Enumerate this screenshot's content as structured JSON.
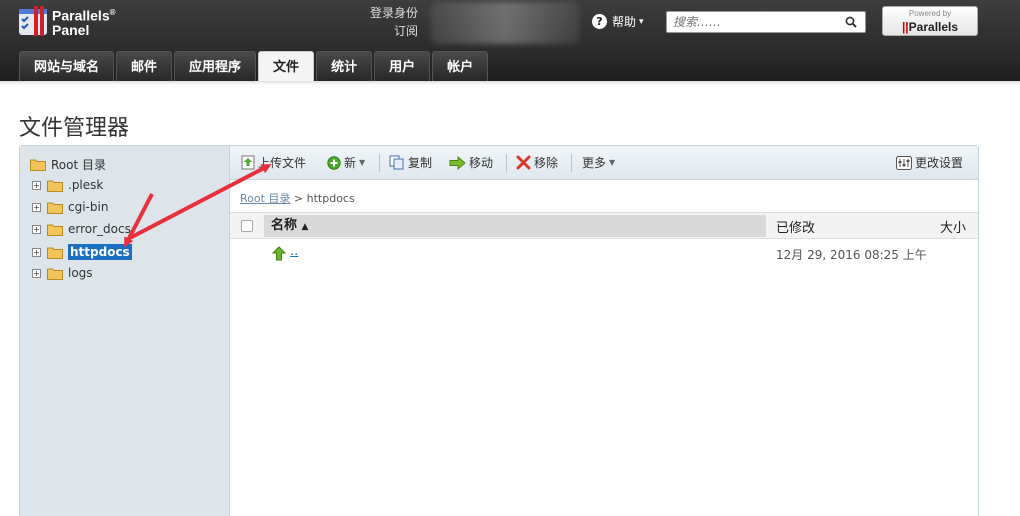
{
  "header": {
    "logo_line1": "Parallels",
    "logo_sup": "®",
    "logo_line2": "Panel",
    "login_label": "登录身份",
    "subscription_label": "订阅",
    "help_label": "帮助",
    "search_placeholder": "搜索……",
    "badge_top": "Powered by",
    "badge_main": "Parallels"
  },
  "tabs": [
    {
      "label": "网站与域名",
      "active": false
    },
    {
      "label": "邮件",
      "active": false
    },
    {
      "label": "应用程序",
      "active": false
    },
    {
      "label": "文件",
      "active": true
    },
    {
      "label": "统计",
      "active": false
    },
    {
      "label": "用户",
      "active": false
    },
    {
      "label": "帐户",
      "active": false
    }
  ],
  "page": {
    "title": "文件管理器"
  },
  "sidebar": {
    "root_label": "Root 目录",
    "items": [
      {
        "label": ".plesk",
        "selected": false
      },
      {
        "label": "cgi-bin",
        "selected": false
      },
      {
        "label": "error_docs",
        "selected": false
      },
      {
        "label": "httpdocs",
        "selected": true
      },
      {
        "label": "logs",
        "selected": false
      }
    ]
  },
  "toolbar": {
    "upload_label": "上传文件",
    "new_label": "新",
    "copy_label": "复制",
    "move_label": "移动",
    "remove_label": "移除",
    "more_label": "更多",
    "settings_label": "更改设置"
  },
  "breadcrumb": {
    "root": "Root 目录",
    "separator": ">",
    "current": "httpdocs"
  },
  "table": {
    "col_name": "名称",
    "col_modified": "已修改",
    "col_size": "大小",
    "rows": [
      {
        "name": "..",
        "modified": "12月 29, 2016 08:25 上午"
      }
    ]
  },
  "colors": {
    "accent": "#1a6fc2",
    "annotation_arrow": "#e8313c"
  }
}
